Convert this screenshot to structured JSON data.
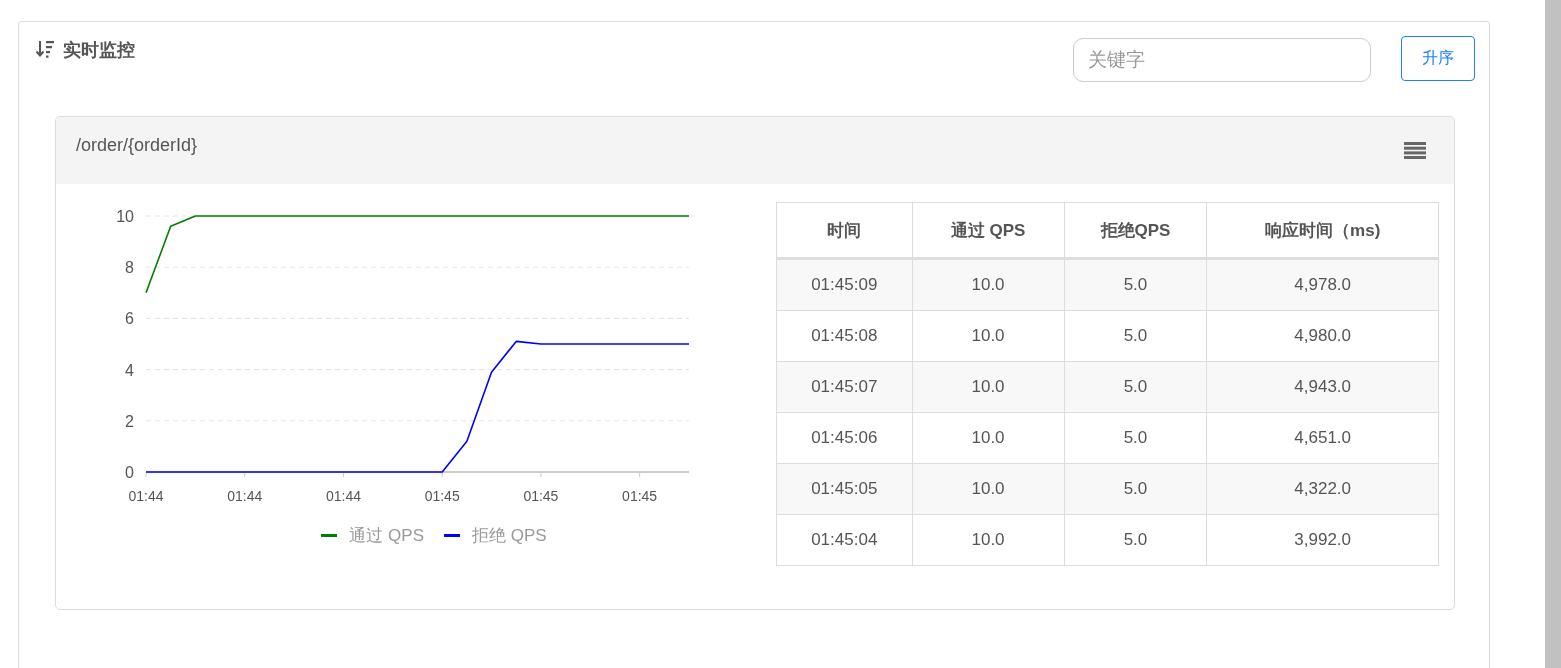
{
  "panel": {
    "title": "实时监控",
    "search": {
      "placeholder": "关键字"
    },
    "sort_button": "升序"
  },
  "card": {
    "title": "/order/{orderId}",
    "chart_data": {
      "type": "line",
      "categories": [
        "01:44",
        null,
        null,
        null,
        "01:44",
        null,
        null,
        null,
        "01:44",
        null,
        null,
        null,
        "01:45",
        null,
        null,
        null,
        "01:45",
        null,
        null,
        null,
        "01:45",
        null,
        null
      ],
      "series": [
        {
          "name": "通过 QPS",
          "color": "#008000",
          "values": [
            7,
            9.6,
            10,
            10,
            10,
            10,
            10,
            10,
            10,
            10,
            10,
            10,
            10,
            10,
            10,
            10,
            10,
            10,
            10,
            10,
            10,
            10,
            10
          ]
        },
        {
          "name": "拒绝 QPS",
          "color": "#0000ff",
          "values": [
            0,
            0,
            0,
            0,
            0,
            0,
            0,
            0,
            0,
            0,
            0,
            0,
            0,
            1.2,
            3.9,
            5.1,
            5,
            5,
            5,
            5,
            5,
            5,
            5
          ]
        }
      ],
      "ylim": [
        0,
        10
      ],
      "grid": true,
      "yticks": [
        0,
        2,
        4,
        6,
        8,
        10
      ]
    },
    "table": {
      "columns": [
        "时间",
        "通过 QPS",
        "拒绝QPS",
        "响应时间（ms)"
      ],
      "rows": [
        [
          "01:45:09",
          "10.0",
          "5.0",
          "4,978.0"
        ],
        [
          "01:45:08",
          "10.0",
          "5.0",
          "4,980.0"
        ],
        [
          "01:45:07",
          "10.0",
          "5.0",
          "4,943.0"
        ],
        [
          "01:45:06",
          "10.0",
          "5.0",
          "4,651.0"
        ],
        [
          "01:45:05",
          "10.0",
          "5.0",
          "4,322.0"
        ],
        [
          "01:45:04",
          "10.0",
          "5.0",
          "3,992.0"
        ]
      ]
    }
  }
}
